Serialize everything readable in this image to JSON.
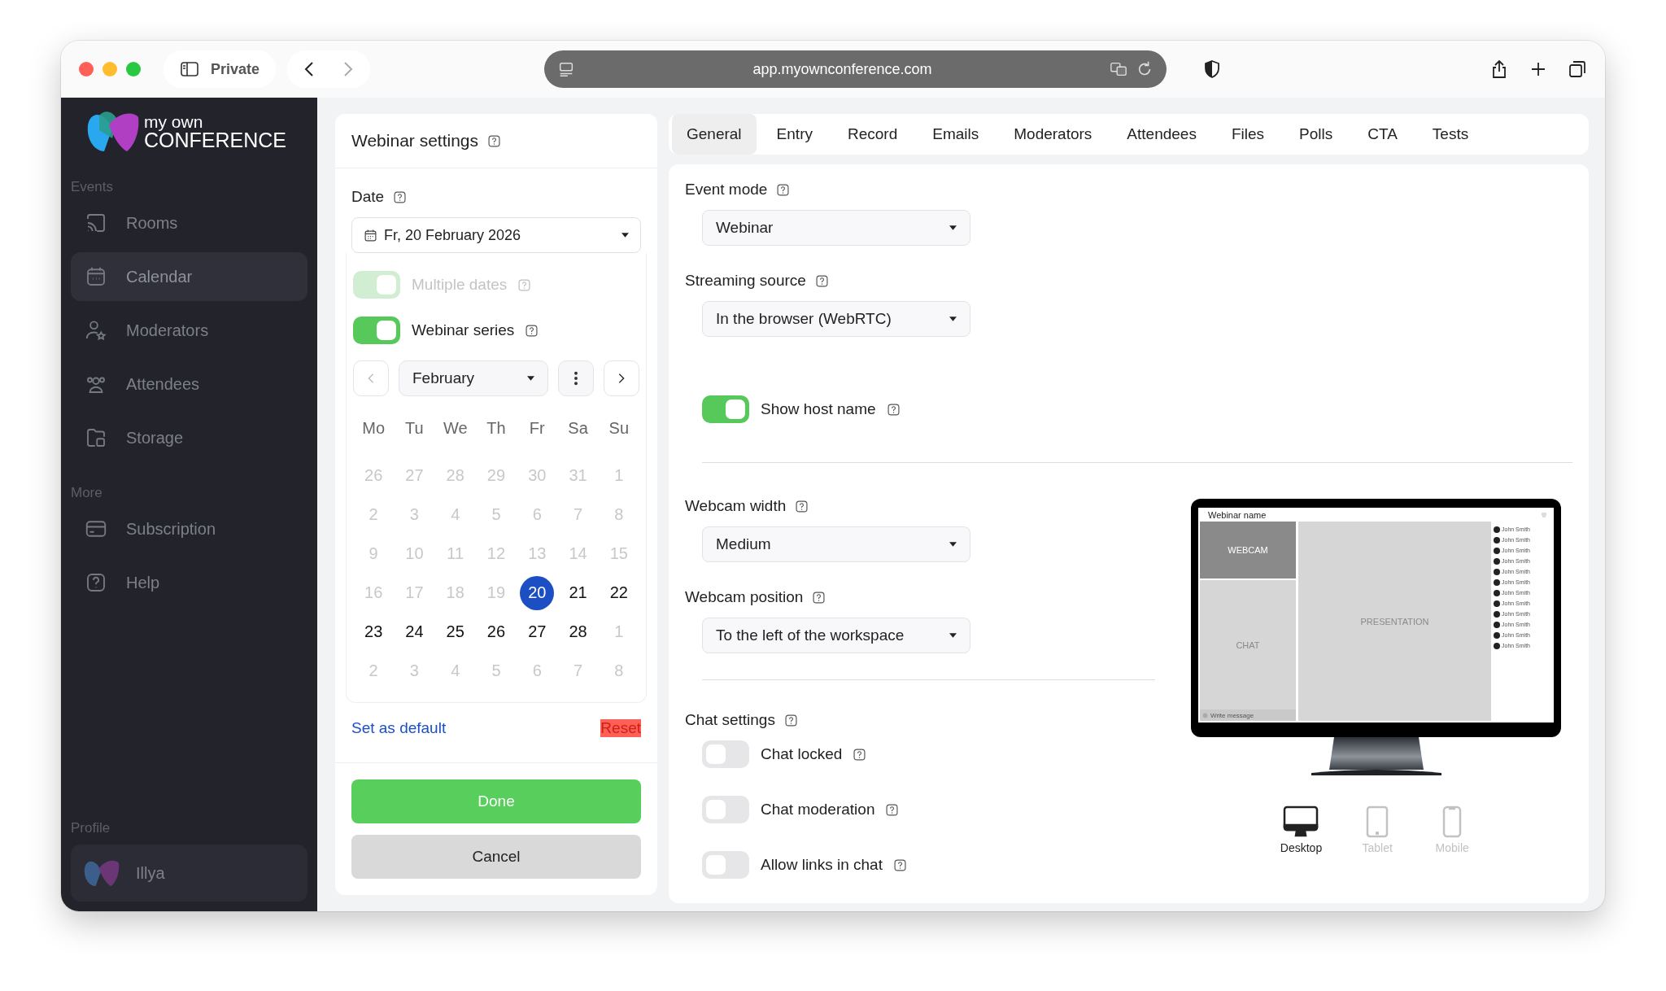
{
  "browser": {
    "private_label": "Private",
    "url": "app.myownconference.com"
  },
  "sidebar": {
    "logo": {
      "line_1": "my own",
      "line_2": "CONFERENCE"
    },
    "sections": [
      {
        "title": "Events",
        "items": [
          {
            "label": "Rooms",
            "selected": false
          },
          {
            "label": "Calendar",
            "selected": true
          },
          {
            "label": "Moderators",
            "selected": false
          },
          {
            "label": "Attendees",
            "selected": false
          },
          {
            "label": "Storage",
            "selected": false
          }
        ]
      },
      {
        "title": "More",
        "items": [
          {
            "label": "Subscription",
            "selected": false
          },
          {
            "label": "Help",
            "selected": false
          }
        ]
      }
    ],
    "profile": {
      "title": "Profile",
      "name": "Illya"
    }
  },
  "settings_panel": {
    "title": "Webinar settings",
    "date": {
      "label": "Date",
      "value": "Fr, 20 February 2026"
    },
    "toggles": [
      {
        "label": "Multiple dates",
        "on": true,
        "disabled": true
      },
      {
        "label": "Webinar series",
        "on": true,
        "disabled": false
      }
    ],
    "calendar": {
      "month": "February",
      "prev_disabled": true,
      "weekdays": [
        "Mo",
        "Tu",
        "We",
        "Th",
        "Fr",
        "Sa",
        "Su"
      ],
      "weeks": [
        [
          {
            "day": "26",
            "muted": true,
            "selected": false
          },
          {
            "day": "27",
            "muted": true,
            "selected": false
          },
          {
            "day": "28",
            "muted": true,
            "selected": false
          },
          {
            "day": "29",
            "muted": true,
            "selected": false
          },
          {
            "day": "30",
            "muted": true,
            "selected": false
          },
          {
            "day": "31",
            "muted": true,
            "selected": false
          },
          {
            "day": "1",
            "muted": true,
            "selected": false
          }
        ],
        [
          {
            "day": "2",
            "muted": true,
            "selected": false
          },
          {
            "day": "3",
            "muted": true,
            "selected": false
          },
          {
            "day": "4",
            "muted": true,
            "selected": false
          },
          {
            "day": "5",
            "muted": true,
            "selected": false
          },
          {
            "day": "6",
            "muted": true,
            "selected": false
          },
          {
            "day": "7",
            "muted": true,
            "selected": false
          },
          {
            "day": "8",
            "muted": true,
            "selected": false
          }
        ],
        [
          {
            "day": "9",
            "muted": true,
            "selected": false
          },
          {
            "day": "10",
            "muted": true,
            "selected": false
          },
          {
            "day": "11",
            "muted": true,
            "selected": false
          },
          {
            "day": "12",
            "muted": true,
            "selected": false
          },
          {
            "day": "13",
            "muted": true,
            "selected": false
          },
          {
            "day": "14",
            "muted": true,
            "selected": false
          },
          {
            "day": "15",
            "muted": true,
            "selected": false
          }
        ],
        [
          {
            "day": "16",
            "muted": true,
            "selected": false
          },
          {
            "day": "17",
            "muted": true,
            "selected": false
          },
          {
            "day": "18",
            "muted": true,
            "selected": false
          },
          {
            "day": "19",
            "muted": true,
            "selected": false
          },
          {
            "day": "20",
            "muted": false,
            "selected": true
          },
          {
            "day": "21",
            "muted": false,
            "selected": false
          },
          {
            "day": "22",
            "muted": false,
            "selected": false
          }
        ],
        [
          {
            "day": "23",
            "muted": false,
            "selected": false
          },
          {
            "day": "24",
            "muted": false,
            "selected": false
          },
          {
            "day": "25",
            "muted": false,
            "selected": false
          },
          {
            "day": "26",
            "muted": false,
            "selected": false
          },
          {
            "day": "27",
            "muted": false,
            "selected": false
          },
          {
            "day": "28",
            "muted": false,
            "selected": false
          },
          {
            "day": "1",
            "muted": true,
            "selected": false
          }
        ],
        [
          {
            "day": "2",
            "muted": true,
            "selected": false
          },
          {
            "day": "3",
            "muted": true,
            "selected": false
          },
          {
            "day": "4",
            "muted": true,
            "selected": false
          },
          {
            "day": "5",
            "muted": true,
            "selected": false
          },
          {
            "day": "6",
            "muted": true,
            "selected": false
          },
          {
            "day": "7",
            "muted": true,
            "selected": false
          },
          {
            "day": "8",
            "muted": true,
            "selected": false
          }
        ]
      ]
    },
    "set_default": "Set as default",
    "reset": "Reset",
    "buttons": [
      {
        "label": "Done",
        "kind": "primary"
      },
      {
        "label": "Cancel",
        "kind": "secondary"
      }
    ]
  },
  "tabs": [
    {
      "label": "General",
      "selected": true
    },
    {
      "label": "Entry",
      "selected": false
    },
    {
      "label": "Record",
      "selected": false
    },
    {
      "label": "Emails",
      "selected": false
    },
    {
      "label": "Moderators",
      "selected": false
    },
    {
      "label": "Attendees",
      "selected": false
    },
    {
      "label": "Files",
      "selected": false
    },
    {
      "label": "Polls",
      "selected": false
    },
    {
      "label": "CTA",
      "selected": false
    },
    {
      "label": "Tests",
      "selected": false
    }
  ],
  "event_settings": [
    {
      "kind": "select",
      "label": "Event mode",
      "value": "Webinar"
    },
    {
      "kind": "select",
      "label": "Streaming source",
      "value": "In the browser (WebRTC)"
    },
    {
      "kind": "toggle",
      "label": "Show host name",
      "on": true
    }
  ],
  "layout_settings": [
    {
      "kind": "select",
      "label": "Webcam width",
      "value": "Medium"
    },
    {
      "kind": "select",
      "label": "Webcam position",
      "value": "To the left of the workspace"
    }
  ],
  "chat_settings": {
    "title": "Chat settings",
    "toggles": [
      {
        "label": "Chat locked",
        "on": false
      },
      {
        "label": "Chat moderation",
        "on": false
      },
      {
        "label": "Allow links in chat",
        "on": false
      }
    ]
  },
  "preview": {
    "webinar_name": "Webinar name",
    "webcam": "WEBCAM",
    "chat": "CHAT",
    "chat_placeholder": "Write message",
    "presentation": "PRESENTATION",
    "attendees": [
      "John Smith",
      "John Smith",
      "John Smith",
      "John Smith",
      "John Smith",
      "John Smith",
      "John Smith",
      "John Smith",
      "John Smith",
      "John Smith",
      "John Smith",
      "John Smith"
    ],
    "devices": [
      {
        "label": "Desktop",
        "kind": "desktop",
        "selected": true
      },
      {
        "label": "Tablet",
        "kind": "tablet",
        "selected": false
      },
      {
        "label": "Mobile",
        "kind": "mobile",
        "selected": false
      }
    ]
  }
}
